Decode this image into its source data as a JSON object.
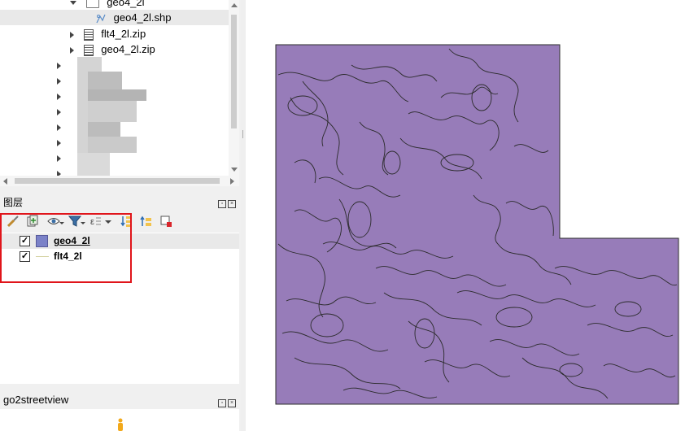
{
  "browser": {
    "items": [
      {
        "label": "geo4_2l",
        "kind": "folder"
      },
      {
        "label": "geo4_2l.shp",
        "kind": "shapefile"
      },
      {
        "label": "flt4_2l.zip",
        "kind": "zip"
      },
      {
        "label": "geo4_2l.zip",
        "kind": "zip"
      }
    ]
  },
  "layers_panel": {
    "title": "图层",
    "layers": [
      {
        "name": "geo4_2l",
        "checked": "✓",
        "symbol": "polygon",
        "color": "#7b82c8"
      },
      {
        "name": "flt4_2l",
        "checked": "✓",
        "symbol": "line",
        "color": "#d4d2a2"
      }
    ]
  },
  "streetview_panel": {
    "title": "go2streetview"
  },
  "map": {
    "fill_color": "#977cb9",
    "outline_color": "#2b2b2b"
  },
  "colors": {
    "highlight_box": "#e0151b",
    "panel_bg": "#f0f0f0",
    "selected_row": "#e9e9e9"
  }
}
